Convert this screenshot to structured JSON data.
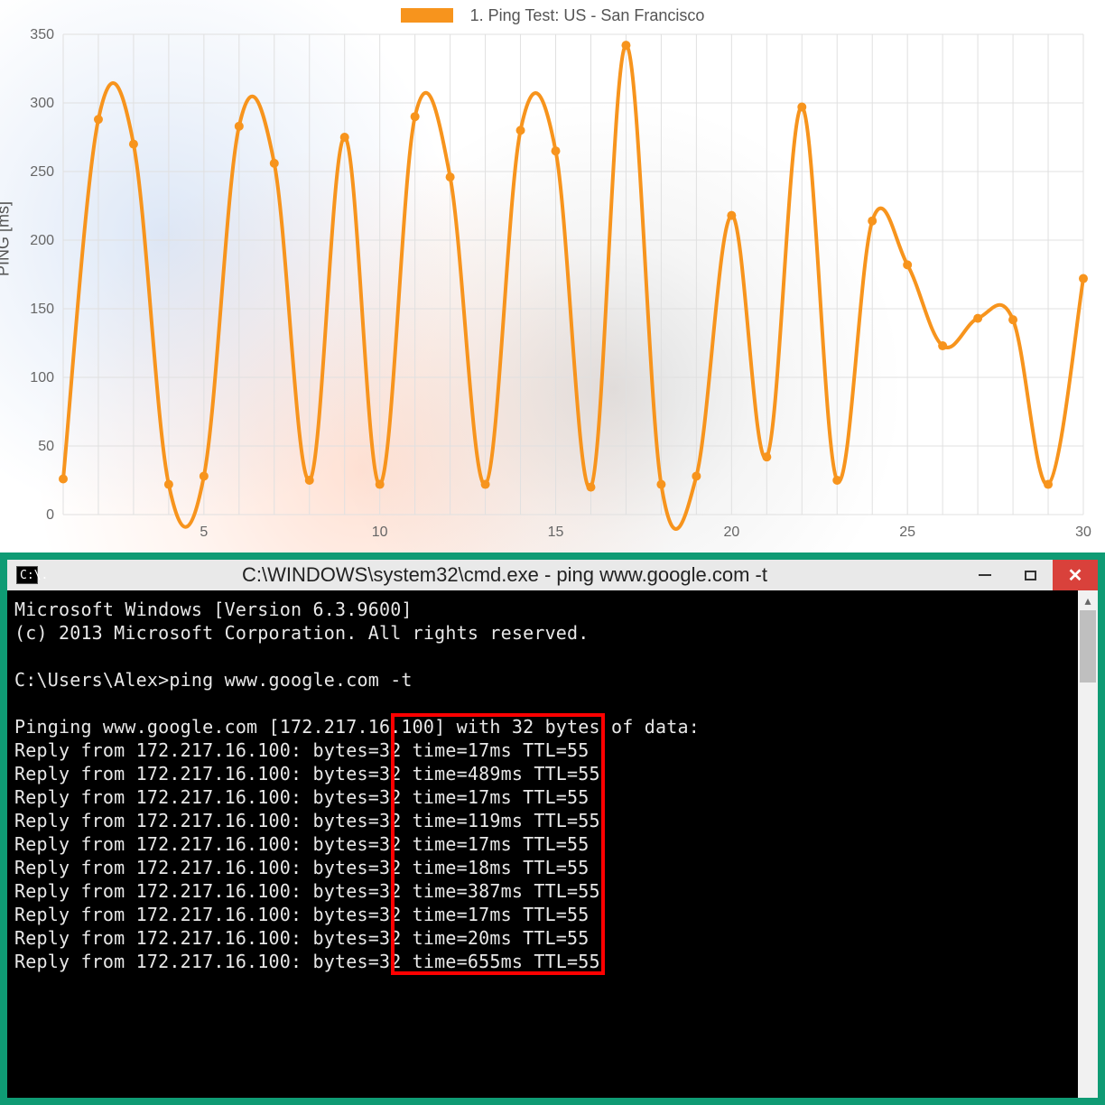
{
  "chart_data": {
    "type": "line",
    "legend": "1. Ping Test: US - San Francisco",
    "ylabel": "PING [ms]",
    "ylim": [
      0,
      350
    ],
    "yticks": [
      0,
      50,
      100,
      150,
      200,
      250,
      300,
      350
    ],
    "xlim": [
      1,
      30
    ],
    "xticks": [
      5,
      10,
      15,
      20,
      25,
      30
    ],
    "color": "#f7941d",
    "x": [
      1,
      2,
      3,
      4,
      5,
      6,
      7,
      8,
      9,
      10,
      11,
      12,
      13,
      14,
      15,
      16,
      17,
      18,
      19,
      20,
      21,
      22,
      23,
      24,
      25,
      26,
      27,
      28,
      29,
      30
    ],
    "values": [
      26,
      288,
      270,
      22,
      28,
      283,
      256,
      25,
      275,
      22,
      290,
      246,
      22,
      280,
      265,
      20,
      342,
      22,
      28,
      218,
      42,
      297,
      25,
      214,
      182,
      123,
      143,
      142,
      22,
      172
    ]
  },
  "cmd": {
    "icon_text": "C:\\.",
    "title": "C:\\WINDOWS\\system32\\cmd.exe - ping  www.google.com -t",
    "lines": [
      "Microsoft Windows [Version 6.3.9600]",
      "(c) 2013 Microsoft Corporation. All rights reserved.",
      "",
      "C:\\Users\\Alex>ping www.google.com -t",
      "",
      "Pinging www.google.com [172.217.16.100] with 32 bytes of data:",
      "Reply from 172.217.16.100: bytes=32 time=17ms TTL=55",
      "Reply from 172.217.16.100: bytes=32 time=489ms TTL=55",
      "Reply from 172.217.16.100: bytes=32 time=17ms TTL=55",
      "Reply from 172.217.16.100: bytes=32 time=119ms TTL=55",
      "Reply from 172.217.16.100: bytes=32 time=17ms TTL=55",
      "Reply from 172.217.16.100: bytes=32 time=18ms TTL=55",
      "Reply from 172.217.16.100: bytes=32 time=387ms TTL=55",
      "Reply from 172.217.16.100: bytes=32 time=17ms TTL=55",
      "Reply from 172.217.16.100: bytes=32 time=20ms TTL=55",
      "Reply from 172.217.16.100: bytes=32 time=655ms TTL=55"
    ],
    "highlight_cols": {
      "start": 35,
      "end": 54
    },
    "highlight_rows": {
      "start": 5,
      "end": 15
    }
  }
}
